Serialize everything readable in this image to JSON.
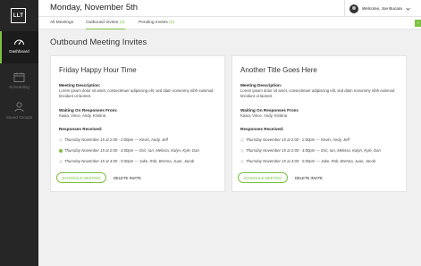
{
  "app": {
    "logo": "LLT"
  },
  "sidebar": {
    "items": [
      {
        "label": "Dashboard",
        "icon": "dashboard-gauge-icon",
        "active": true
      },
      {
        "label": "Scheduling",
        "icon": "calendar-icon",
        "active": false
      },
      {
        "label": "Saved Groups",
        "icon": "people-icon",
        "active": false
      }
    ]
  },
  "header": {
    "date": "Monday, November 5th",
    "welcome": "Welcome, Joe Bucara"
  },
  "tabs": [
    {
      "label": "All Meetings",
      "count": ""
    },
    {
      "label": "Outbound Invites",
      "count": "(2)"
    },
    {
      "label": "Pending Invites",
      "count": "(3)"
    }
  ],
  "tab_flag": "!",
  "page": {
    "title": "Outbound Meeting Invites"
  },
  "labels": {
    "description": "Meeting Description:",
    "waiting": "Waiting On Responses From:",
    "responses": "Responses Received:",
    "schedule": "SCHEDULE MEETING",
    "delete": "DELETE INVITE"
  },
  "cards": [
    {
      "title": "Friday Happy Hour Time",
      "description": "Lorem ipsum dolor sit amet, consectetuer adipiscing elit, sed diam nonummy nibh euismod tincidunt ut laoreet.",
      "waiting": "Kasia, Vince, Andy, Kristina",
      "responses": [
        {
          "text": "Thursday November 15 at 2:00 - 2:00pm — Kevin, Andy, Jeff",
          "selected": false
        },
        {
          "text": "Thursday November 15 at 2:00 - 4:00pm — Eric, Ian, Melissa, Kalyn, Kyle, Dan",
          "selected": true
        },
        {
          "text": "Thursday November 15 at 4:00 - 5:00pm — Jake, Rob, Brenna, Juan, Jacob",
          "selected": false
        }
      ]
    },
    {
      "title": "Another Title Goes Here",
      "description": "Lorem ipsum dolor sit amet, consectetuer adipiscing elit, sed diam nonummy nibh euismod tincidunt ut laoreet.",
      "waiting": "Kasia, Vince, Andy, Kristina",
      "responses": [
        {
          "text": "Thursday November 15 at 2:00 - 2:00pm — Kevin, Andy, Jeff",
          "selected": false
        },
        {
          "text": "Thursday November 15 at 2:00 - 4:00pm — Eric, Ian, Melissa, Kalyn, Kyle, Dan",
          "selected": false
        },
        {
          "text": "Thursday November 15 at 4:00 - 5:00pm — Jake, Rob, Brenna, Juan, Jacob",
          "selected": false
        }
      ]
    }
  ],
  "colors": {
    "accent": "#7dc242",
    "sidebar": "#262626",
    "background": "#f0f0f0"
  }
}
